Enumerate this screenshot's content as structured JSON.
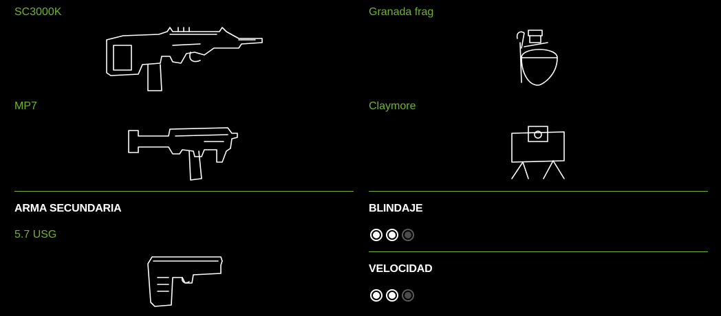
{
  "primary_weapons": [
    {
      "name": "SC3000K",
      "icon": "assault-rifle-icon"
    },
    {
      "name": "MP7",
      "icon": "smg-icon"
    }
  ],
  "gadgets": [
    {
      "name": "Granada frag",
      "icon": "frag-grenade-icon"
    },
    {
      "name": "Claymore",
      "icon": "claymore-icon"
    }
  ],
  "secondary": {
    "heading": "ARMA SECUNDARIA",
    "weapons": [
      {
        "name": "5.7 USG",
        "icon": "pistol-icon"
      }
    ]
  },
  "stats": {
    "armor": {
      "label": "BLINDAJE",
      "value": 2,
      "max": 3
    },
    "speed": {
      "label": "VELOCIDAD",
      "value": 2,
      "max": 3
    }
  },
  "colors": {
    "accent": "#6fb52c",
    "background": "#000000",
    "heading": "#ffffff"
  }
}
